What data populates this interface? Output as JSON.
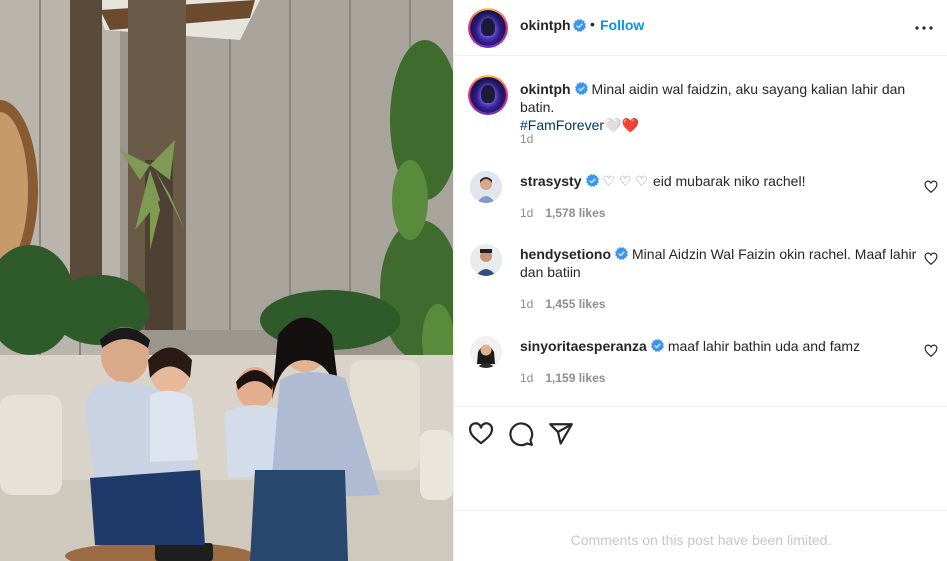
{
  "post": {
    "author": "okintph",
    "follow_label": "Follow",
    "separator": "•",
    "more_icon": "more-horizontal-icon"
  },
  "caption": {
    "username": "okintph",
    "text": "Minal aidin wal faidzin, aku sayang kalian lahir dan batin.",
    "hashtag": "#FamForever",
    "emoji": "🤍❤️",
    "time": "1d"
  },
  "comments": [
    {
      "username": "strasysty",
      "text": "eid mubarak niko rachel!",
      "prefix_emoji": "♡ ♡ ♡",
      "time": "1d",
      "likes": "1,578 likes"
    },
    {
      "username": "hendysetiono",
      "text": "Minal Aidzin Wal Faizin okin rachel. Maaf lahir dan batiin",
      "time": "1d",
      "likes": "1,455 likes"
    },
    {
      "username": "sinyoritaesperanza",
      "text": "maaf lahir bathin uda and famz",
      "time": "1d",
      "likes": "1,159 likes"
    }
  ],
  "actions": {
    "like_icon": "heart-icon",
    "comment_icon": "comment-icon",
    "share_icon": "send-icon"
  },
  "footer": {
    "limited_text": "Comments on this post have been limited."
  },
  "colors": {
    "accent": "#0095f6",
    "verified": "#3897f0",
    "hashtag": "#00376b",
    "muted": "#8e8e8e",
    "heart": "#ed4956"
  }
}
